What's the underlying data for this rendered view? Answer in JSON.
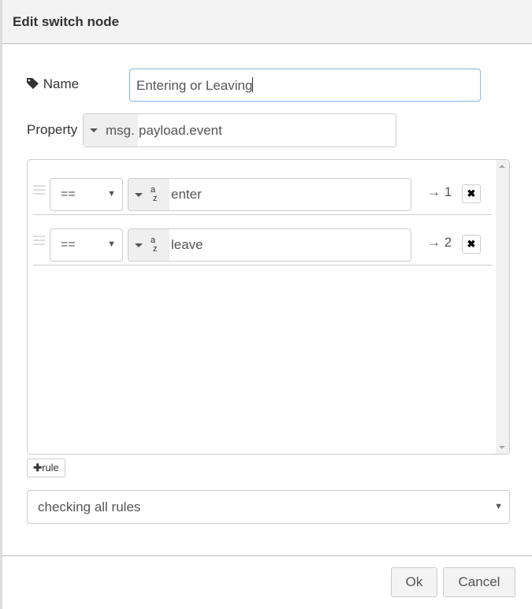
{
  "dialog": {
    "title": "Edit switch node"
  },
  "name": {
    "label": "Name",
    "value": "Entering or Leaving",
    "icon": "tag-icon"
  },
  "property": {
    "label": "Property",
    "type": "msg.",
    "value": "payload.event"
  },
  "rules": [
    {
      "operator": "==",
      "value_type": "az",
      "value": "enter",
      "output": "→ 1"
    },
    {
      "operator": "==",
      "value_type": "az",
      "value": "leave",
      "output": "→ 2"
    }
  ],
  "add_rule_label": "rule",
  "mode": {
    "value": "checking all rules"
  },
  "buttons": {
    "ok": "Ok",
    "cancel": "Cancel"
  },
  "colors": {
    "focus_border": "#85b7e8",
    "header_bg": "#f3f3f3"
  }
}
